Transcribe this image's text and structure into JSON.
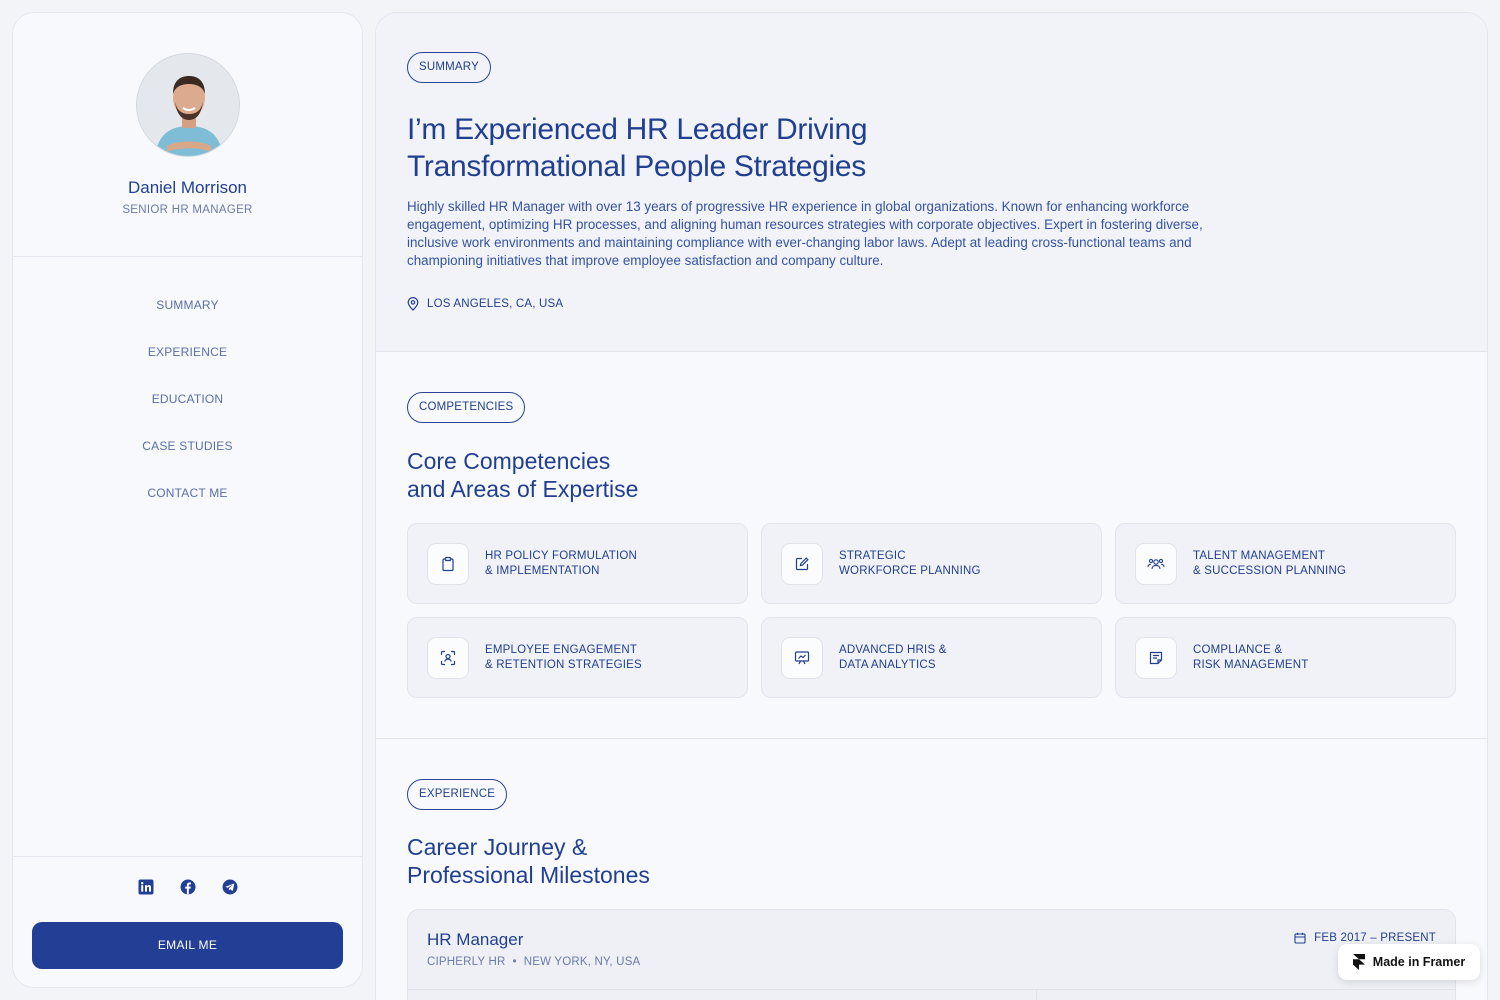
{
  "profile": {
    "name": "Daniel Morrison",
    "role": "SENIOR HR MANAGER"
  },
  "nav": {
    "items": [
      {
        "label": "SUMMARY"
      },
      {
        "label": "EXPERIENCE"
      },
      {
        "label": "EDUCATION"
      },
      {
        "label": "CASE STUDIES"
      },
      {
        "label": "CONTACT ME"
      }
    ]
  },
  "socials": [
    "linkedin-icon",
    "facebook-icon",
    "telegram-icon"
  ],
  "email_button": "EMAIL ME",
  "summary": {
    "pill": "SUMMARY",
    "headline_line1": "I’m Experienced HR Leader Driving",
    "headline_line2": "Transformational People Strategies",
    "bio": "Highly skilled HR Manager with over 13 years of progressive HR experience in global organizations. Known for enhancing workforce engagement, optimizing HR processes, and aligning human resources strategies with corporate objectives. Expert in fostering diverse, inclusive work environments and maintaining compliance with ever-changing labor laws. Adept at leading cross-functional teams and championing initiatives that improve employee satisfaction and company culture.",
    "location": "LOS ANGELES, CA, USA"
  },
  "competencies": {
    "pill": "COMPETENCIES",
    "title_line1": "Core Competencies",
    "title_line2": "and Areas of Expertise",
    "items": [
      {
        "line1": "HR POLICY FORMULATION",
        "line2": "& IMPLEMENTATION",
        "icon": "clipboard-icon"
      },
      {
        "line1": "STRATEGIC",
        "line2": "WORKFORCE PLANNING",
        "icon": "edit-icon"
      },
      {
        "line1": "TALENT MANAGEMENT",
        "line2": "& SUCCESSION PLANNING",
        "icon": "users-icon"
      },
      {
        "line1": "EMPLOYEE ENGAGEMENT",
        "line2": "& RETENTION STRATEGIES",
        "icon": "user-focus-icon"
      },
      {
        "line1": "ADVANCED HRIS &",
        "line2": "DATA ANALYTICS",
        "icon": "presentation-chart-icon"
      },
      {
        "line1": "COMPLIANCE &",
        "line2": "RISK MANAGEMENT",
        "icon": "document-icon"
      }
    ]
  },
  "experience": {
    "pill": "EXPERIENCE",
    "title_line1": "Career Journey &",
    "title_line2": "Professional Milestones",
    "job": {
      "title": "HR Manager",
      "company": "CIPHERLY HR",
      "location": "NEW YORK, NY, USA",
      "dates": "FEB 2017 – PRESENT"
    }
  },
  "badge": "Made in Framer",
  "colors": {
    "accent": "#233f95",
    "text": "#213f90",
    "muted": "#6c7ca8",
    "background": "#f3f4f8"
  }
}
